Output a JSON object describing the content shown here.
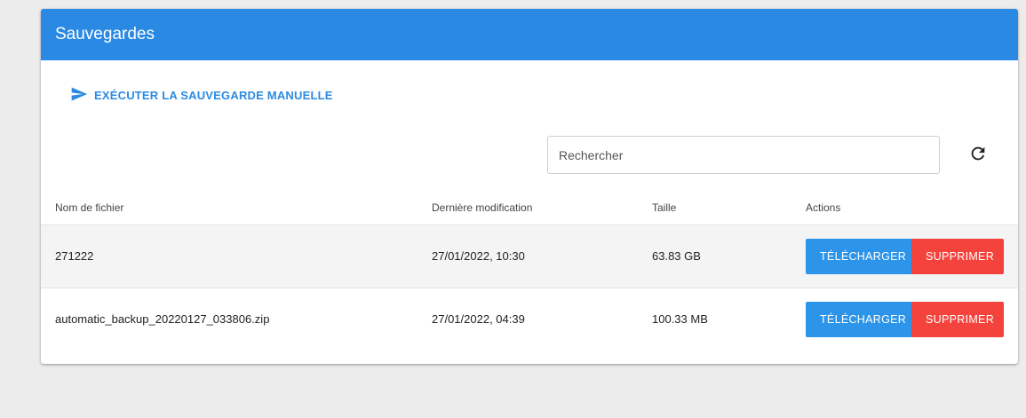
{
  "header": {
    "title": "Sauvegardes"
  },
  "toolbar": {
    "manual_backup_label": "EXÉCUTER LA SAUVEGARDE MANUELLE"
  },
  "search": {
    "placeholder": "Rechercher",
    "value": ""
  },
  "table": {
    "columns": {
      "name": "Nom de fichier",
      "modified": "Dernière modification",
      "size": "Taille",
      "actions": "Actions"
    },
    "rows": [
      {
        "name": "271222",
        "modified": "27/01/2022, 10:30",
        "size": "63.83 GB",
        "download_label": "TÉLÉCHARGER",
        "delete_label": "SUPPRIMER"
      },
      {
        "name": "automatic_backup_20220127_033806.zip",
        "modified": "27/01/2022, 04:39",
        "size": "100.33 MB",
        "download_label": "TÉLÉCHARGER",
        "delete_label": "SUPPRIMER"
      }
    ]
  },
  "icons": {
    "manual_backup": "send-icon",
    "refresh": "refresh-icon"
  },
  "colors": {
    "header": "#2989e3",
    "accent": "#2c8be0",
    "download": "#2c95ea",
    "delete": "#f3433c"
  }
}
